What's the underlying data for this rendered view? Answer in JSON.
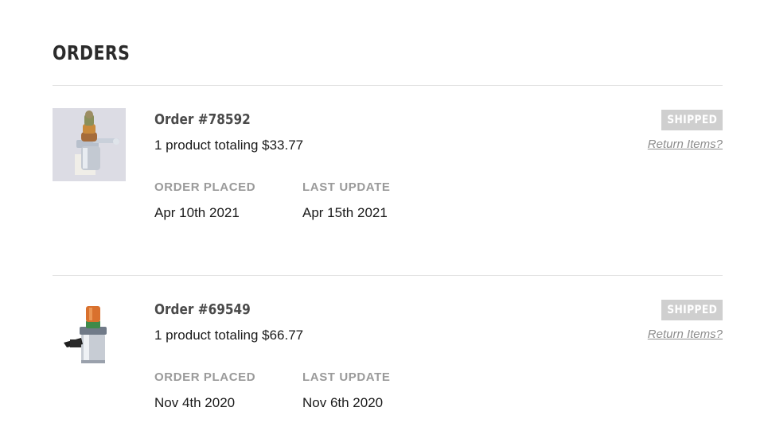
{
  "page": {
    "title": "ORDERS"
  },
  "orders": [
    {
      "number": "Order #78592",
      "summary": "1 product totaling $33.77",
      "status": "SHIPPED",
      "return_link": "Return Items?",
      "placed_label": "ORDER PLACED",
      "placed_date": "Apr 10th 2021",
      "update_label": "LAST UPDATE",
      "update_date": "Apr 15th 2021",
      "image": "solenoid-product-photo"
    },
    {
      "number": "Order #69549",
      "summary": "1 product totaling $66.77",
      "status": "SHIPPED",
      "return_link": "Return Items?",
      "placed_label": "ORDER PLACED",
      "placed_date": "Nov 4th 2020",
      "update_label": "LAST UPDATE",
      "update_date": "Nov 6th 2020",
      "image": "solenoid-product-photo"
    }
  ],
  "colors": {
    "badge_background": "#cfcfcf",
    "badge_text": "#ffffff",
    "label_gray": "#9a9a9a",
    "divider": "#e3e3e3",
    "link_gray": "#8e8e8e"
  }
}
